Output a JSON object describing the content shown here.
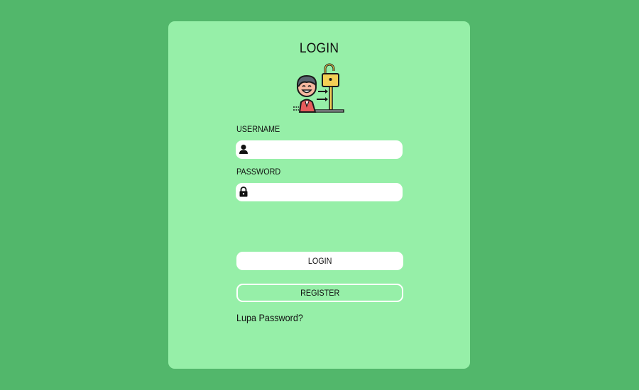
{
  "page": {
    "background_color": "#52b76b",
    "card_color": "#96efa8"
  },
  "login_form": {
    "title": "LOGIN",
    "illustration_icon": "person-unlock-illustration-icon",
    "username": {
      "label": "USERNAME",
      "value": "",
      "icon": "user-icon"
    },
    "password": {
      "label": "PASSWORD",
      "value": "",
      "icon": "lock-icon"
    },
    "login_button": "LOGIN",
    "register_button": "REGISTER",
    "forgot_link": "Lupa Password?"
  }
}
